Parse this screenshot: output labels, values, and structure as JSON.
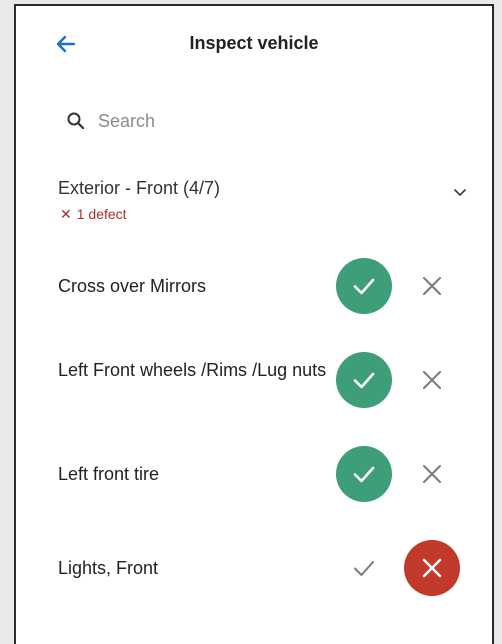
{
  "header": {
    "title": "Inspect vehicle",
    "back_icon": "arrow-left-icon"
  },
  "search": {
    "placeholder": "Search",
    "value": ""
  },
  "section": {
    "title": "Exterior - Front (4/7)",
    "defect_mark": "✕",
    "defect_text": "1 defect",
    "expanded": true
  },
  "items": [
    {
      "label": "Cross over Mirrors",
      "status": "pass"
    },
    {
      "label": "Left Front  wheels /Rims /Lug nuts",
      "status": "pass"
    },
    {
      "label": "Left front tire",
      "status": "pass"
    },
    {
      "label": "Lights, Front",
      "status": "fail"
    }
  ],
  "colors": {
    "accent_blue": "#1a6fcf",
    "pass_green": "#3d9e78",
    "fail_red": "#c0392b",
    "defect_text": "#b32a2a",
    "icon_gray": "#7a7a7a"
  }
}
